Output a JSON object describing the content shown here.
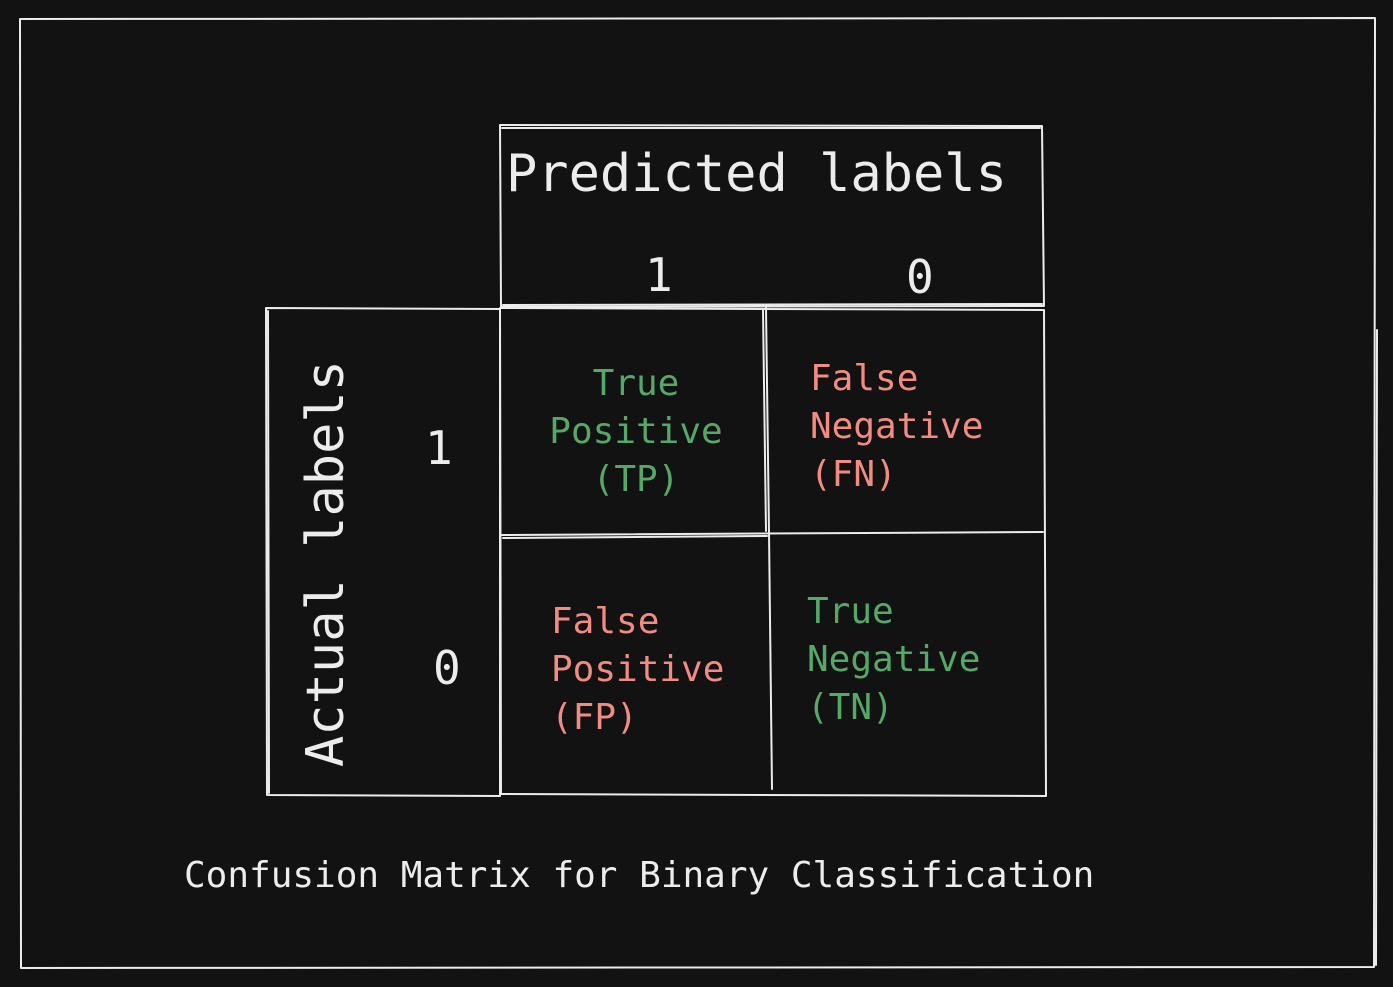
{
  "diagram": {
    "predicted_header": "Predicted labels",
    "actual_header": "Actual labels",
    "predicted_ticks": [
      "1",
      "0"
    ],
    "actual_ticks": [
      "1",
      "0"
    ],
    "cells": [
      {
        "id": "tp",
        "lines": [
          "True",
          "Positive",
          "(TP)"
        ],
        "color": "#55a868"
      },
      {
        "id": "fn",
        "lines": [
          "False",
          "Negative",
          "(FN)"
        ],
        "color": "#f28b82"
      },
      {
        "id": "fp",
        "lines": [
          "False",
          "Positive",
          "(FP)"
        ],
        "color": "#f28b82"
      },
      {
        "id": "tn",
        "lines": [
          "True",
          "Negative",
          "(TN)"
        ],
        "color": "#55a868"
      }
    ],
    "caption": "Confusion Matrix for Binary Classification",
    "colors": {
      "background": "#121212",
      "stroke": "#ececec",
      "correct": "#55a868",
      "error": "#f28b82"
    }
  }
}
